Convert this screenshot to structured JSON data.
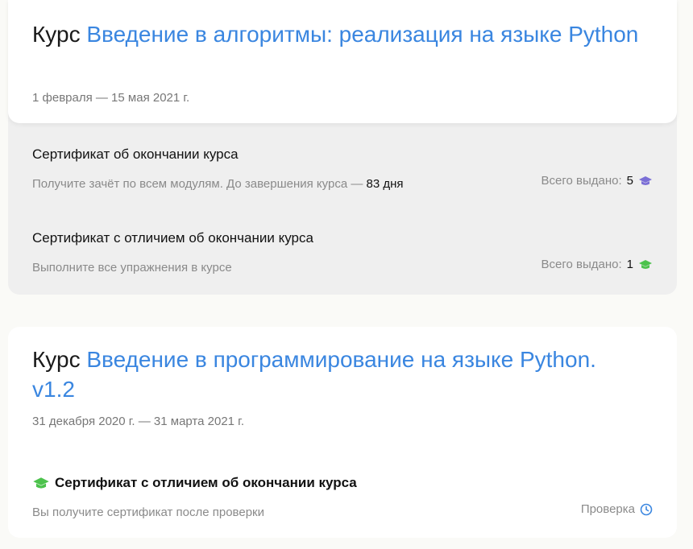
{
  "courses": [
    {
      "keyword": "Курс",
      "name": "Введение в алгоритмы: реализация на языке Python",
      "dates": "1 февраля — 15 мая 2021 г.",
      "certificates": [
        {
          "title": "Сертификат об окончании курса",
          "description": "Получите зачёт по всем модулям. До завершения курса —",
          "description_highlight": "83 дня",
          "issued_label": "Всего выдано:",
          "issued_count": "5",
          "icon": "graduation-cap-icon",
          "icon_color": "#7b6fd6"
        },
        {
          "title": "Сертификат с отличием об окончании курса",
          "description": "Выполните все упражнения в курсе",
          "issued_label": "Всего выдано:",
          "issued_count": "1",
          "icon": "graduation-cap-icon",
          "icon_color": "#4cc24c"
        }
      ]
    },
    {
      "keyword": "Курс",
      "name": "Введение в программирование на языке Python. v1.2",
      "dates": "31 декабря 2020 г. — 31 марта 2021 г.",
      "certificates": [
        {
          "title": "Сертификат с отличием об окончании курса",
          "description": "Вы получите сертификат после проверки",
          "status": "Проверка",
          "icon": "graduation-cap-icon",
          "icon_color": "#4cc24c",
          "status_icon": "clock-icon",
          "status_icon_color": "#3a86e0"
        }
      ]
    }
  ],
  "colors": {
    "link": "#3a86e0",
    "muted": "#8a8a8a"
  }
}
